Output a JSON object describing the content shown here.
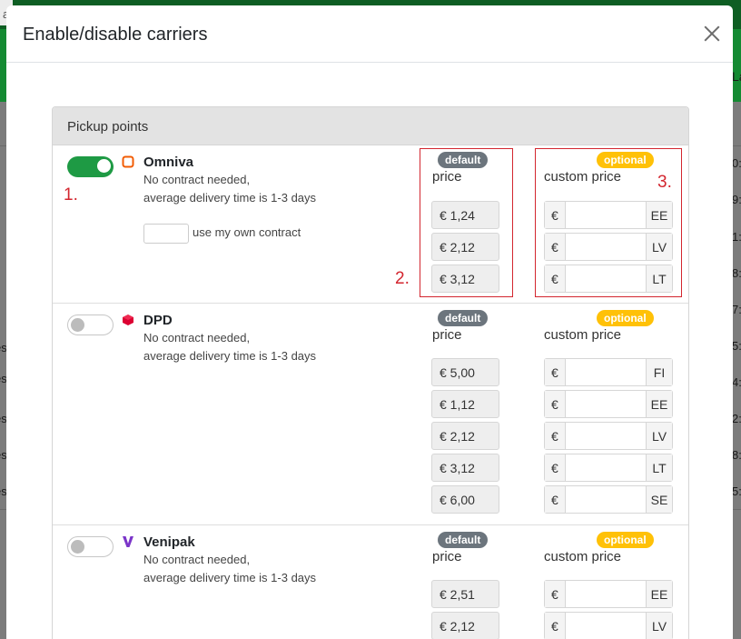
{
  "background": {
    "topbar_fragment": "a",
    "header_fragment": "La",
    "left_fragments": [
      "es",
      "es",
      "es",
      "es",
      "es"
    ],
    "right_fragments": [
      "0:",
      "9:",
      "1:",
      "8:",
      "7:",
      "5:",
      "4:",
      "2:",
      "8:",
      "5:"
    ]
  },
  "modal": {
    "title": "Enable/disable carriers",
    "close_label": "×",
    "section_title": "Pickup points"
  },
  "labels": {
    "default_badge": "default",
    "optional_badge": "optional",
    "price_label": "price",
    "custom_price_label": "custom price",
    "currency_symbol": "€",
    "own_contract_label": "use my own contract"
  },
  "annotations": [
    "1.",
    "2.",
    "3."
  ],
  "carriers": [
    {
      "name": "Omniva",
      "enabled": true,
      "logo_color": "#f25c05",
      "desc_line1": "No contract needed,",
      "desc_line2": "average delivery time is 1-3 days",
      "prices": [
        {
          "value": "€ 1,24",
          "country": "EE"
        },
        {
          "value": "€ 2,12",
          "country": "LV"
        },
        {
          "value": "€ 3,12",
          "country": "LT"
        }
      ]
    },
    {
      "name": "DPD",
      "enabled": false,
      "logo_color": "#dc0032",
      "desc_line1": "No contract needed,",
      "desc_line2": "average delivery time is 1-3 days",
      "prices": [
        {
          "value": "€ 5,00",
          "country": "FI"
        },
        {
          "value": "€ 1,12",
          "country": "EE"
        },
        {
          "value": "€ 2,12",
          "country": "LV"
        },
        {
          "value": "€ 3,12",
          "country": "LT"
        },
        {
          "value": "€ 6,00",
          "country": "SE"
        }
      ]
    },
    {
      "name": "Venipak",
      "enabled": false,
      "logo_color": "#7b35c9",
      "desc_line1": "No contract needed,",
      "desc_line2": "average delivery time is 1-3 days",
      "prices": [
        {
          "value": "€ 2,51",
          "country": "EE"
        },
        {
          "value": "€ 2,12",
          "country": "LV"
        }
      ]
    }
  ]
}
